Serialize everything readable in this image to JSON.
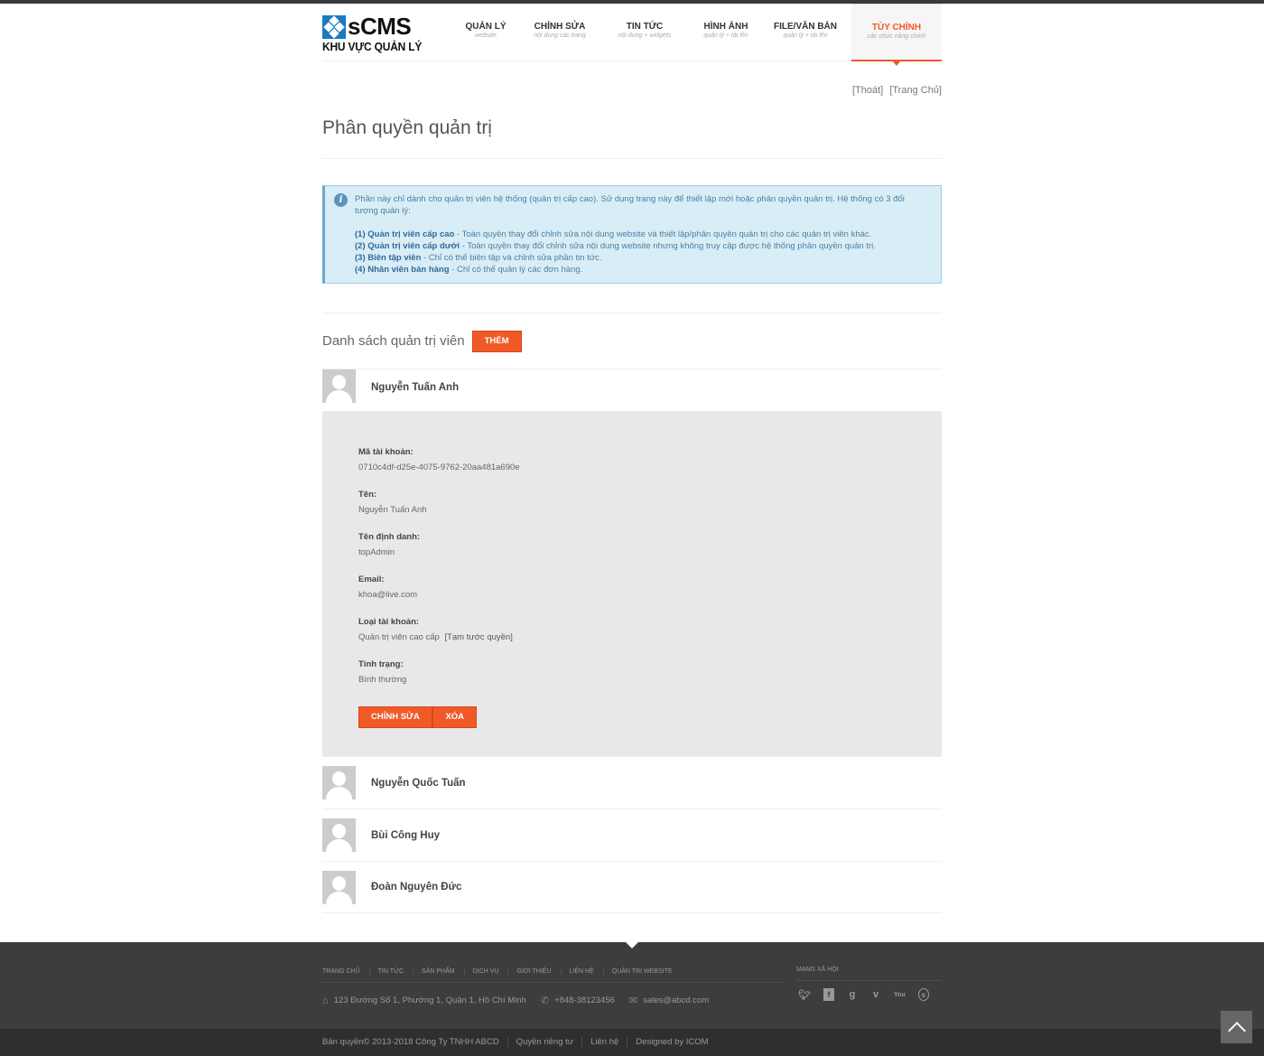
{
  "header": {
    "logo_brand": "sCMS",
    "logo_sub": "KHU VỰC QUẢN LÝ",
    "nav": [
      {
        "title": "QUẢN LÝ",
        "sub": "website"
      },
      {
        "title": "CHỈNH SỬA",
        "sub": "nội dung các trang"
      },
      {
        "title": "TIN TỨC",
        "sub": "nội dung + widgets"
      },
      {
        "title": "HÌNH ẢNH",
        "sub": "quản lý + tải lên"
      },
      {
        "title": "FILE/VĂN BẢN",
        "sub": "quản lý + tải lên"
      },
      {
        "title": "TÙY CHỈNH",
        "sub": "các chức năng chính"
      }
    ],
    "active_nav": "TÙY CHỈNH"
  },
  "toplinks": {
    "logout": "[Thoát]",
    "home": "[Trang Chủ]"
  },
  "page_title": "Phân quyền quản trị",
  "info": {
    "intro": "Phần này chỉ dành cho quản trị viên hệ thống (quản trị cấp cao). Sử dụng trang này để thiết lập mới hoặc phân quyền quản trị. Hệ thống có 3 đối tượng quản lý:",
    "roles": [
      {
        "name": "(1) Quản trị viên cấp cao",
        "desc": " - Toàn quyền thay đổi chỉnh sửa nội dung website và thiết lập/phân quyền quản trị cho các quản trị viên khác."
      },
      {
        "name": "(2) Quản trị viên cấp dưới",
        "desc": " - Toàn quyền thay đổi chỉnh sửa nội dung website nhưng không truy cập được hệ thống phân quyền quản trị."
      },
      {
        "name": "(3) Biên tập viên",
        "desc": " - Chỉ có thể biên tập và chỉnh sửa phần tin tức."
      },
      {
        "name": "(4) Nhân viên bán hàng",
        "desc": " - Chỉ có thể quản lý các đơn hàng."
      }
    ]
  },
  "list": {
    "heading": "Danh sách quản trị viên",
    "add_label": "THÊM",
    "users": [
      {
        "name": "Nguyễn Tuấn Anh"
      },
      {
        "name": "Nguyễn Quốc Tuấn"
      },
      {
        "name": "Bùi Công Huy"
      },
      {
        "name": "Đoàn Nguyên Đức"
      }
    ]
  },
  "detail": {
    "account_id_label": "Mã tài khoản:",
    "account_id": "0710c4df-d25e-4075-9762-20aa481a690e",
    "name_label": "Tên:",
    "name": "Nguyễn Tuấn Anh",
    "username_label": "Tên định danh:",
    "username": "topAdmin",
    "email_label": "Email:",
    "email": "khoa@live.com",
    "type_label": "Loại tài khoản:",
    "type": "Quản trị viên cao cấp",
    "suspend_link": "[Tạm tước quyền]",
    "status_label": "Tình trạng:",
    "status": "Bình thường",
    "edit_label": "CHỈNH SỬA",
    "delete_label": "XÓA"
  },
  "footer": {
    "nav": [
      "TRANG CHỦ",
      "TIN TỨC",
      "SẢN PHẨM",
      "DỊCH VỤ",
      "GIỚI THIỆU",
      "LIÊN HỆ",
      "QUẢN TRỊ WEBSITE"
    ],
    "address": "123 Đường Số 1, Phường 1, Quận 1, Hồ Chí Minh",
    "phone": "+848-38123456",
    "email": "sales@abcd.com",
    "social_title": "MẠNG XÃ HỘI",
    "social_icons": [
      "twitter-icon",
      "facebook-icon",
      "google-plus-icon",
      "vimeo-icon",
      "youtube-icon",
      "skype-icon"
    ],
    "copyright": "Bản quyền© 2013-2018 Công Ty TNHH ABCD",
    "privacy": "Quyền riêng tư",
    "contact": "Liên hệ",
    "designed": "Designed by ICOM"
  },
  "colors": {
    "accent": "#f05a28",
    "info_bg": "#d9edf7",
    "footer_bg": "#3d3d3d"
  }
}
